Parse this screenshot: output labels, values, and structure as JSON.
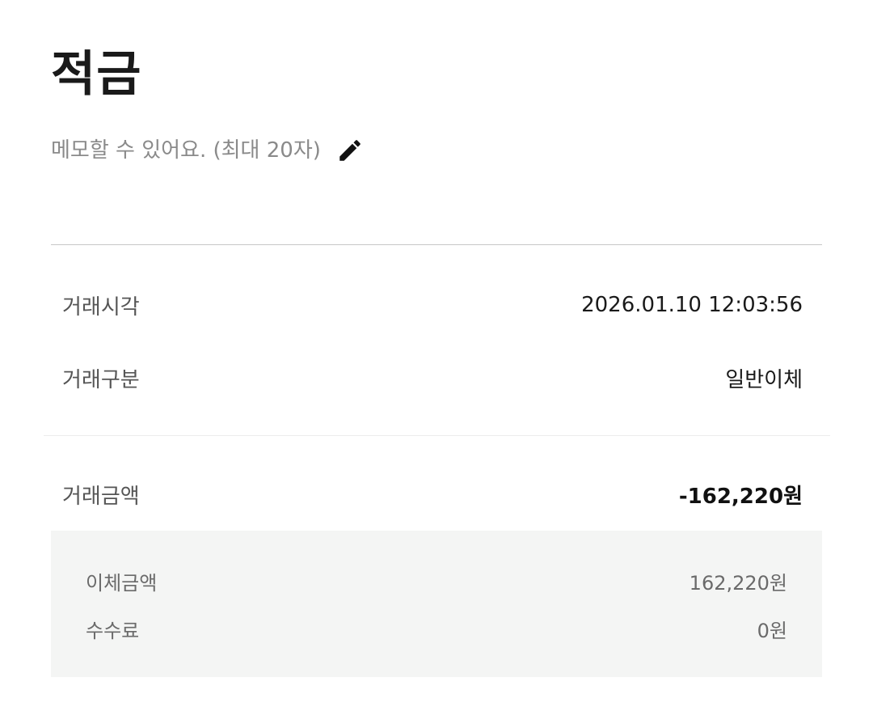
{
  "header": {
    "title": "적금",
    "memo_placeholder": "메모할 수 있어요. (최대 20자)",
    "edit_icon": "pencil-icon"
  },
  "transaction": {
    "time_label": "거래시각",
    "time_value": "2026.01.10 12:03:56",
    "type_label": "거래구분",
    "type_value": "일반이체",
    "amount_label": "거래금액",
    "amount_value": "-162,220원"
  },
  "details": {
    "transfer_label": "이체금액",
    "transfer_value": "162,220원",
    "fee_label": "수수료",
    "fee_value": "0원"
  },
  "colors": {
    "detail_background": "#f4f5f4",
    "placeholder_text": "#8a8a8a"
  }
}
